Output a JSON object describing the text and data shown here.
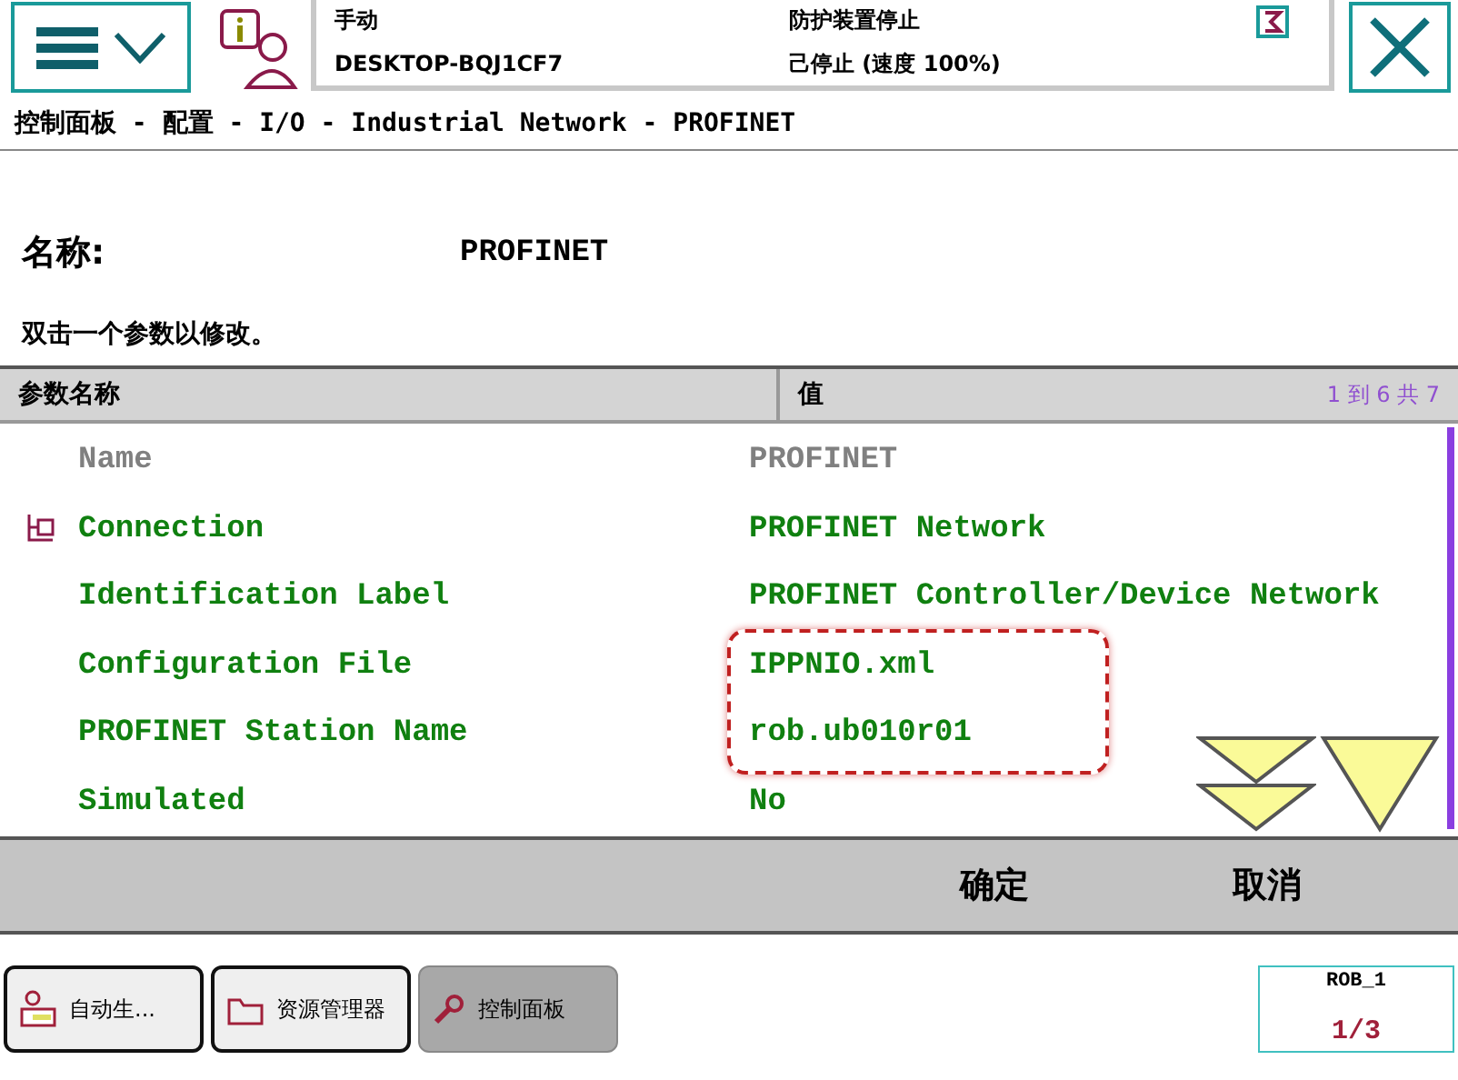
{
  "status": {
    "mode": "手动",
    "host": "DESKTOP-BQJ1CF7",
    "safety": "防护装置停止",
    "state": "己停止 (速度 100%)"
  },
  "breadcrumb": "控制面板 - 配置 - I/O - Industrial Network - PROFINET",
  "name_label": "名称:",
  "name_value": "PROFINET",
  "hint": "双击一个参数以修改。",
  "table": {
    "columns": [
      "参数名称",
      "值"
    ],
    "range": "1 到 6 共 7",
    "rows": [
      {
        "name": "Name",
        "value": "PROFINET",
        "disabled": true,
        "linked": false
      },
      {
        "name": "Connection",
        "value": "PROFINET Network",
        "disabled": false,
        "linked": true
      },
      {
        "name": "Identification Label",
        "value": "PROFINET Controller/Device Network",
        "disabled": false,
        "linked": false
      },
      {
        "name": "Configuration File",
        "value": "IPPNIO.xml",
        "disabled": false,
        "linked": false
      },
      {
        "name": "PROFINET Station Name",
        "value": "rob.ub010r01",
        "disabled": false,
        "linked": false
      },
      {
        "name": "Simulated",
        "value": "No",
        "disabled": false,
        "linked": false
      }
    ]
  },
  "actions": [
    "确定",
    "取消"
  ],
  "taskbar": [
    {
      "label": "自动生...",
      "kind": "user",
      "selected": false
    },
    {
      "label": "资源管理器",
      "kind": "folder",
      "selected": false
    },
    {
      "label": "控制面板",
      "kind": "wrench",
      "selected": true
    }
  ],
  "robot": {
    "label": "ROB_1",
    "fraction": "1/3"
  }
}
